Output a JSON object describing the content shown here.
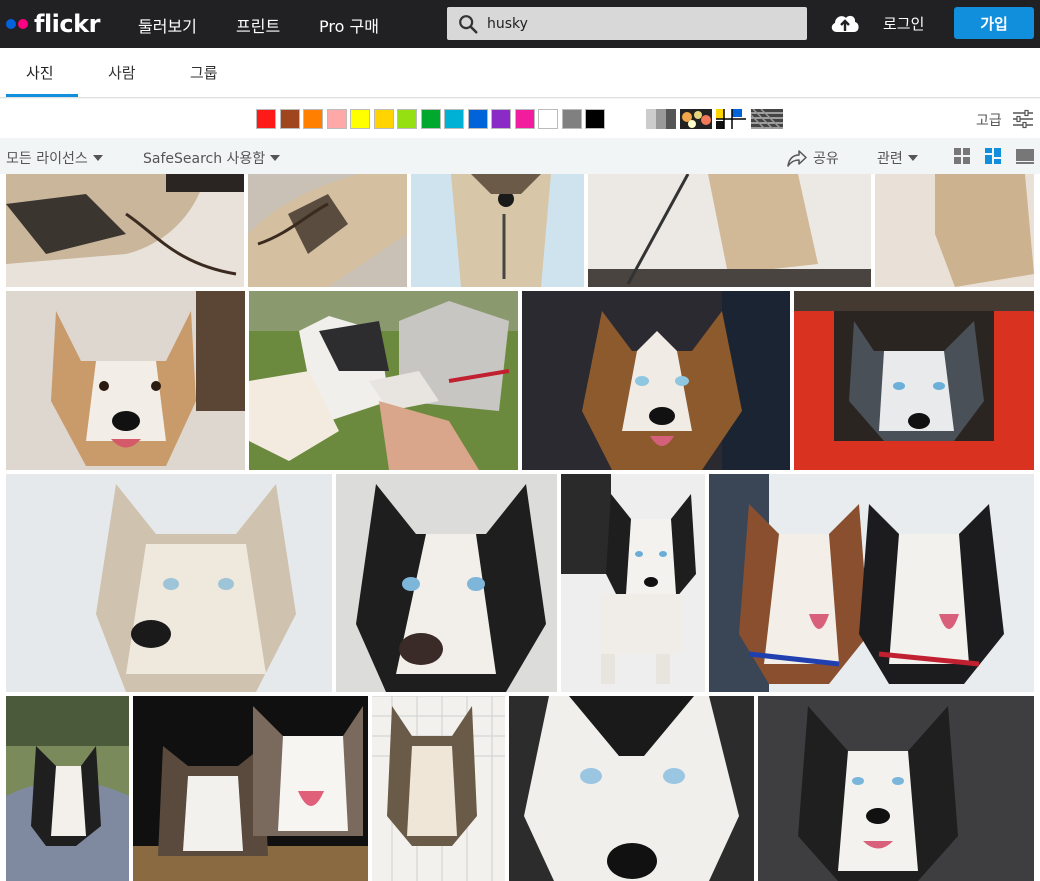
{
  "nav": {
    "logo": "flickr",
    "explore": "둘러보기",
    "prints": "프린트",
    "pro": "Pro 구매",
    "login": "로그인",
    "join": "가입"
  },
  "search": {
    "value": "husky",
    "icon": "search-icon"
  },
  "tabs": {
    "photos": "사진",
    "people": "사람",
    "groups": "그룹"
  },
  "colors": [
    "#ff1a1a",
    "#a0461e",
    "#ff7f00",
    "#ffa8a8",
    "#ffff00",
    "#ffd400",
    "#94e011",
    "#00a92e",
    "#00b1d6",
    "#0064d8",
    "#8a2bc7",
    "#f21c9e",
    "#ffffff",
    "#808080",
    "#000000"
  ],
  "advanced": "고급",
  "filters": {
    "license": "모든 라이선스",
    "safesearch": "SafeSearch 사용함",
    "share": "공유",
    "relevant": "관련"
  },
  "views": [
    "grid-small-icon",
    "justified-icon",
    "large-view-icon"
  ]
}
